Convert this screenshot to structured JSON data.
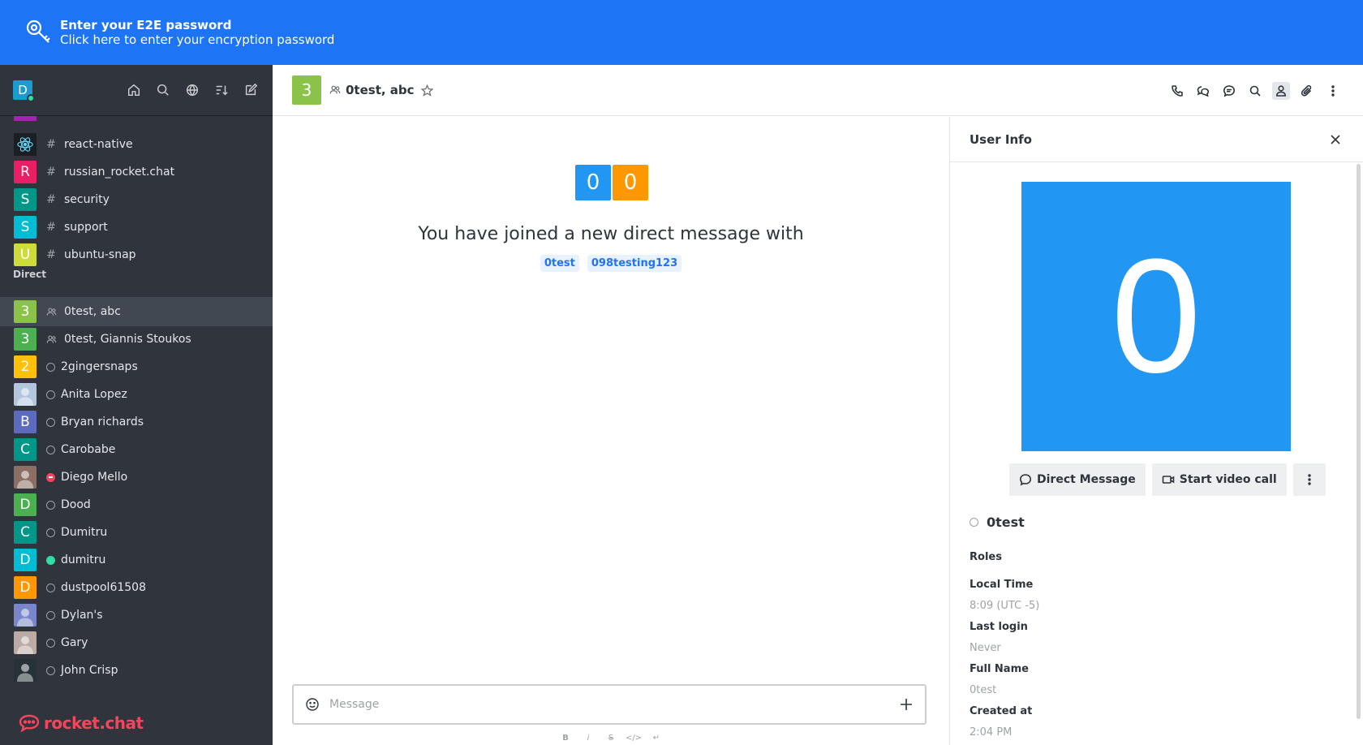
{
  "banner": {
    "title": "Enter your E2E password",
    "subtitle": "Click here to enter your encryption password"
  },
  "sidebar": {
    "user_initial": "D",
    "channels": [
      {
        "name": "react-native",
        "avatar": "",
        "color": "#1b1e22"
      },
      {
        "name": "russian_rocket.chat",
        "avatar": "R",
        "color": "#e91e63"
      },
      {
        "name": "security",
        "avatar": "S",
        "color": "#009688"
      },
      {
        "name": "support",
        "avatar": "S",
        "color": "#00bcd4"
      },
      {
        "name": "ubuntu-snap",
        "avatar": "U",
        "color": "#cddc39"
      }
    ],
    "direct_label": "Direct",
    "directs": [
      {
        "name": "0test, abc",
        "avatar": "3",
        "color": "#8bc34a",
        "type": "group",
        "status": "",
        "active": true
      },
      {
        "name": "0test, Giannis Stoukos",
        "avatar": "3",
        "color": "#4caf50",
        "type": "group",
        "status": "",
        "active": false
      },
      {
        "name": "2gingersnaps",
        "avatar": "2",
        "color": "#ffc107",
        "type": "user",
        "status": "offline",
        "active": false
      },
      {
        "name": "Anita Lopez",
        "avatar": "",
        "color": "#b3c6de",
        "type": "user",
        "status": "offline",
        "active": false
      },
      {
        "name": "Bryan richards",
        "avatar": "B",
        "color": "#5c6bc0",
        "type": "user",
        "status": "offline",
        "active": false
      },
      {
        "name": "Carobabe",
        "avatar": "C",
        "color": "#009688",
        "type": "user",
        "status": "offline",
        "active": false
      },
      {
        "name": "Diego Mello",
        "avatar": "",
        "color": "#8d6e63",
        "type": "user",
        "status": "busy",
        "active": false
      },
      {
        "name": "Dood",
        "avatar": "D",
        "color": "#4caf50",
        "type": "user",
        "status": "offline",
        "active": false
      },
      {
        "name": "Dumitru",
        "avatar": "C",
        "color": "#009688",
        "type": "user",
        "status": "offline",
        "active": false
      },
      {
        "name": "dumitru",
        "avatar": "D",
        "color": "#00bcd4",
        "type": "user",
        "status": "online",
        "active": false
      },
      {
        "name": "dustpool61508",
        "avatar": "D",
        "color": "#ff9800",
        "type": "user",
        "status": "offline",
        "active": false
      },
      {
        "name": "Dylan's",
        "avatar": "",
        "color": "#7986cb",
        "type": "user",
        "status": "offline",
        "active": false
      },
      {
        "name": "Gary",
        "avatar": "",
        "color": "#bcaaa4",
        "type": "user",
        "status": "offline",
        "active": false
      },
      {
        "name": "John Crisp",
        "avatar": "",
        "color": "#263238",
        "type": "user",
        "status": "offline",
        "active": false
      }
    ],
    "logo_text": "rocket.chat"
  },
  "room": {
    "avatar": "3",
    "name": "0test, abc"
  },
  "main": {
    "intro_avatars": [
      "0",
      "0"
    ],
    "intro_title": "You have joined a new direct message with",
    "mentions": [
      "0test",
      "098testing123"
    ],
    "composer_placeholder": "Message"
  },
  "user_info": {
    "title": "User Info",
    "avatar_initial": "0",
    "direct_message_label": "Direct Message",
    "video_call_label": "Start video call",
    "username": "0test",
    "roles_label": "Roles",
    "local_time_label": "Local Time",
    "local_time": "8:09 (UTC -5)",
    "last_login_label": "Last login",
    "last_login": "Never",
    "full_name_label": "Full Name",
    "full_name": "0test",
    "created_at_label": "Created at",
    "created_at": "2:04 PM"
  },
  "colors": {
    "banner": "#1d74f5",
    "sidebar": "#2f343d",
    "accent": "#1d74f5",
    "big_avatar": "#2196f3",
    "intro_avatar_1": "#2196f3",
    "intro_avatar_2": "#ff9800"
  }
}
